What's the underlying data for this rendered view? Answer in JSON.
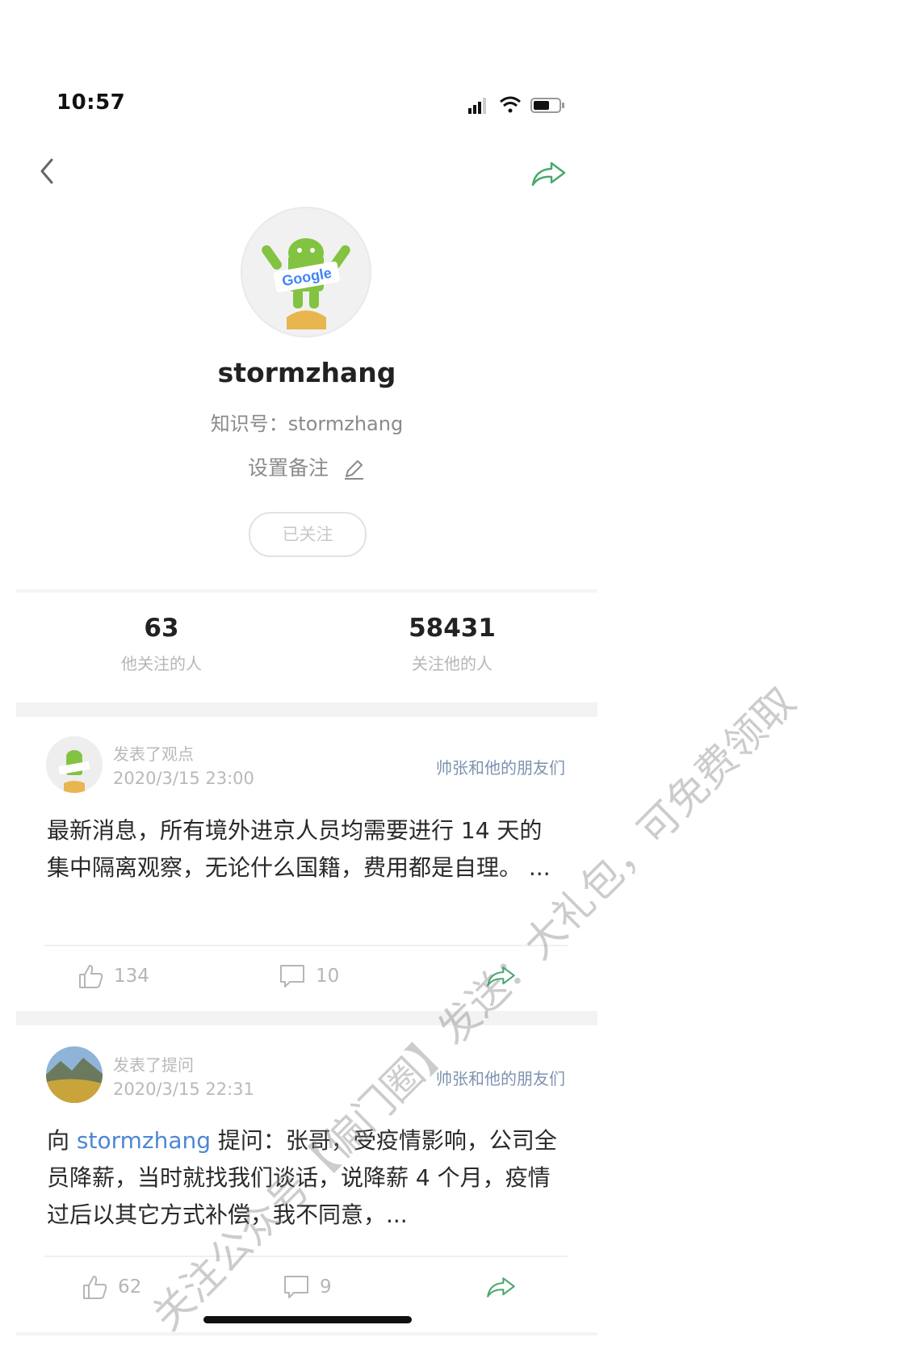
{
  "status_bar": {
    "time": "10:57"
  },
  "profile": {
    "username": "stormzhang",
    "zhishi_label": "知识号：",
    "zhishi_id": "stormzhang",
    "remark_label": "设置备注",
    "follow_button": "已关注",
    "avatar_text": "Google"
  },
  "stats": [
    {
      "value": "63",
      "label": "他关注的人"
    },
    {
      "value": "58431",
      "label": "关注他的人"
    }
  ],
  "posts": [
    {
      "type": "发表了观点",
      "time": "2020/3/15 23:00",
      "circle": "帅张和他的朋友们",
      "body": "最新消息，所有境外进京人员均需要进行 14 天的集中隔离观察，无论什么国籍，费用都是自理。 ...",
      "likes": "134",
      "comments": "10"
    },
    {
      "type": "发表了提问",
      "time": "2020/3/15 22:31",
      "circle": "帅张和他的朋友们",
      "body_prefix": "向 ",
      "mention": "stormzhang",
      "body": " 提问：张哥，受疫情影响，公司全员降薪，当时就找我们谈话，说降薪 4 个月，疫情过后以其它方式补偿，我不同意，...",
      "likes": "62",
      "comments": "9"
    }
  ],
  "watermark": "关注公众号【偏门圈】发送：大礼包，可免费领取",
  "colors": {
    "accent_green": "#49a86f",
    "link_blue": "#4d86d6",
    "circle_blue": "#7d93b0"
  }
}
